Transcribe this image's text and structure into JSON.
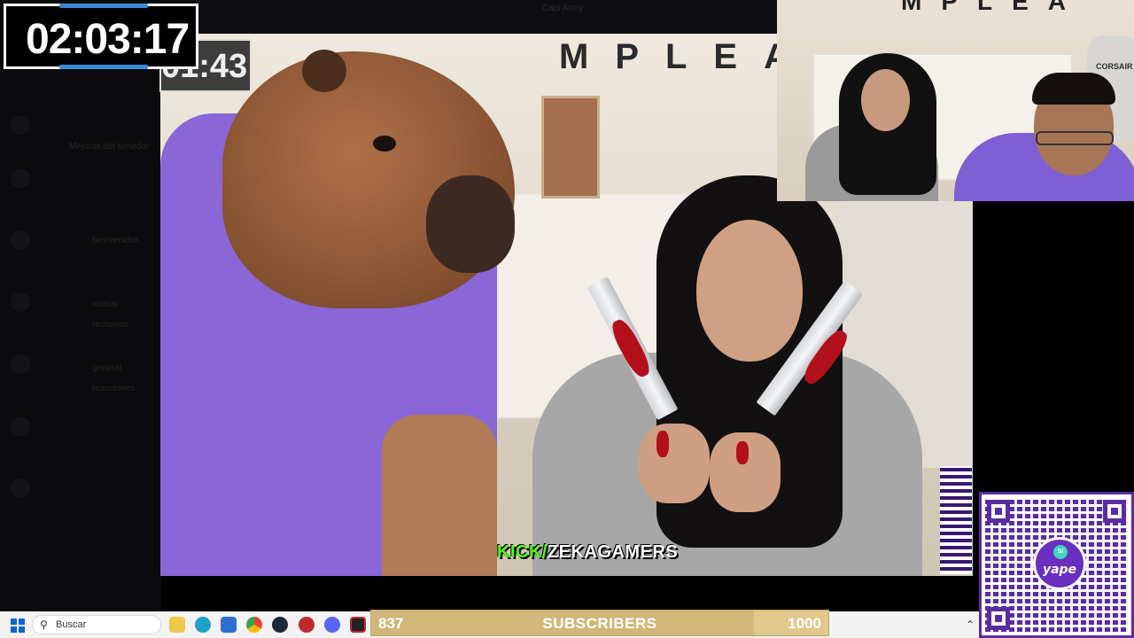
{
  "timer": {
    "value": "02:03:17"
  },
  "video_timer": {
    "value": "01:43"
  },
  "capture_window": {
    "title": "Capi Army"
  },
  "video": {
    "subtitle_prefix": "KICK/",
    "subtitle_channel": "ZEKAGAMERS",
    "banner": "MPLEA"
  },
  "webcam": {
    "banner": "MPLEA",
    "chair_brand": "CORSAIR"
  },
  "sidebar_bg": {
    "items": [
      "Mejoras del servidor",
      "bienvenidos",
      "videos",
      "reclamos",
      "general",
      "reacciones"
    ]
  },
  "taskbar": {
    "search_placeholder": "Buscar",
    "apps": [
      "file-explorer",
      "edge",
      "store",
      "chrome",
      "steam",
      "app-red",
      "discord",
      "epic-games"
    ]
  },
  "subscriber_goal": {
    "current": "837",
    "label": "SUBSCRIBERS",
    "goal": "1000",
    "progress": 0.837
  },
  "yape": {
    "brand": "yape",
    "currency": "S/"
  },
  "colors": {
    "kick_green": "#53fc18",
    "yape_purple": "#5b2ca0",
    "timer_accent": "#3a8bdc",
    "subbar": "#e2c88d"
  }
}
